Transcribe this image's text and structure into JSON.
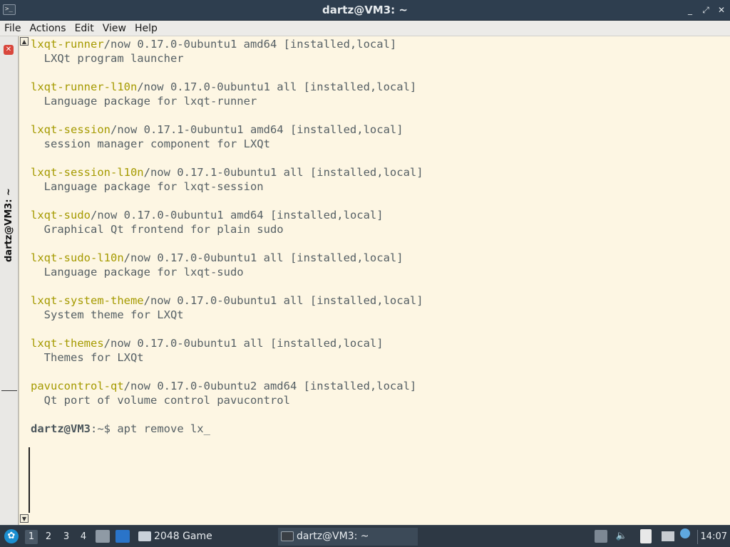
{
  "window": {
    "title": "dartz@VM3: ~",
    "controls": {
      "minimize": "_",
      "maximize": "⤢",
      "close": "✕"
    }
  },
  "menu": {
    "items": [
      "File",
      "Actions",
      "Edit",
      "View",
      "Help"
    ]
  },
  "tab": {
    "label": "dartz@VM3: ~",
    "close_glyph": "✕"
  },
  "terminal": {
    "lines": [
      {
        "pkg": "lxqt-runner",
        "rest": "/now 0.17.0-0ubuntu1 amd64 [installed,local]"
      },
      {
        "pkg": "",
        "rest": "  LXQt program launcher"
      },
      {
        "pkg": "",
        "rest": ""
      },
      {
        "pkg": "lxqt-runner-l10n",
        "rest": "/now 0.17.0-0ubuntu1 all [installed,local]"
      },
      {
        "pkg": "",
        "rest": "  Language package for lxqt-runner"
      },
      {
        "pkg": "",
        "rest": ""
      },
      {
        "pkg": "lxqt-session",
        "rest": "/now 0.17.1-0ubuntu1 amd64 [installed,local]"
      },
      {
        "pkg": "",
        "rest": "  session manager component for LXQt"
      },
      {
        "pkg": "",
        "rest": ""
      },
      {
        "pkg": "lxqt-session-l10n",
        "rest": "/now 0.17.1-0ubuntu1 all [installed,local]"
      },
      {
        "pkg": "",
        "rest": "  Language package for lxqt-session"
      },
      {
        "pkg": "",
        "rest": ""
      },
      {
        "pkg": "lxqt-sudo",
        "rest": "/now 0.17.0-0ubuntu1 amd64 [installed,local]"
      },
      {
        "pkg": "",
        "rest": "  Graphical Qt frontend for plain sudo"
      },
      {
        "pkg": "",
        "rest": ""
      },
      {
        "pkg": "lxqt-sudo-l10n",
        "rest": "/now 0.17.0-0ubuntu1 all [installed,local]"
      },
      {
        "pkg": "",
        "rest": "  Language package for lxqt-sudo"
      },
      {
        "pkg": "",
        "rest": ""
      },
      {
        "pkg": "lxqt-system-theme",
        "rest": "/now 0.17.0-0ubuntu1 all [installed,local]"
      },
      {
        "pkg": "",
        "rest": "  System theme for LXQt"
      },
      {
        "pkg": "",
        "rest": ""
      },
      {
        "pkg": "lxqt-themes",
        "rest": "/now 0.17.0-0ubuntu1 all [installed,local]"
      },
      {
        "pkg": "",
        "rest": "  Themes for LXQt"
      },
      {
        "pkg": "",
        "rest": ""
      },
      {
        "pkg": "pavucontrol-qt",
        "rest": "/now 0.17.0-0ubuntu2 amd64 [installed,local]"
      },
      {
        "pkg": "",
        "rest": "  Qt port of volume control pavucontrol"
      },
      {
        "pkg": "",
        "rest": ""
      }
    ],
    "prompt_user": "dartz@VM3",
    "prompt_rest": ":~$ apt remove lx_"
  },
  "taskbar": {
    "workspaces": [
      "1",
      "2",
      "3",
      "4"
    ],
    "active_workspace": "1",
    "tasks": [
      {
        "label": "2048 Game"
      },
      {
        "label": "dartz@VM3: ~"
      }
    ],
    "clock": "14:07",
    "colors": {
      "accent": "#1b8fd1",
      "package_name": "#a59a00"
    }
  }
}
